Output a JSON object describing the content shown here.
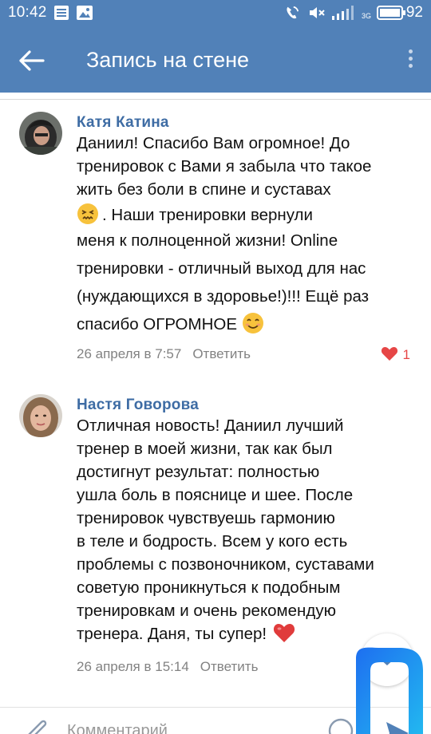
{
  "status_bar": {
    "time": "10:42",
    "network": "3G",
    "battery": "92"
  },
  "header": {
    "title": "Запись на стене"
  },
  "comments": [
    {
      "author": "Катя Катина",
      "lines": [
        "Даниил! Спасибо Вам огромное! До",
        "тренировок с Вами я забыла что такое",
        "жить без боли в спине и суставах",
        ". Наши тренировки вернули",
        "меня к полноценной жизни! Online",
        "тренировки - отличный выход для нас",
        "(нуждающихся в  здоровье!)!!! Ещё раз",
        "спасибо ОГРОМНОЕ"
      ],
      "date": "26 апреля в 7:57",
      "reply_label": "Ответить",
      "likes": "1",
      "emojis": [
        "persevering-face-emoji",
        "smiling-face-emoji"
      ]
    },
    {
      "author": "Настя Говорова",
      "lines": [
        "Отличная новость! Даниил лучший",
        "тренер в моей жизни, так как был",
        "достигнут результат: полностью",
        "ушла боль в пояснице и шее. После",
        "тренировок чувствуешь гармонию",
        "в теле и бодрость. Всем у кого есть",
        "проблемы с позвоночником, суставами",
        "советую проникнуться к подобным",
        "тренировкам и очень рекомендую",
        "тренера. Даня, ты супер!"
      ],
      "date": "26 апреля в 15:14",
      "reply_label": "Ответить",
      "emojis": [
        "red-heart-emoji"
      ]
    }
  ],
  "input_bar": {
    "placeholder": "Комментарий"
  },
  "colors": {
    "header_bg": "#5181b8",
    "author": "#3e6ca4",
    "meta": "#828282",
    "like": "#e64646"
  }
}
